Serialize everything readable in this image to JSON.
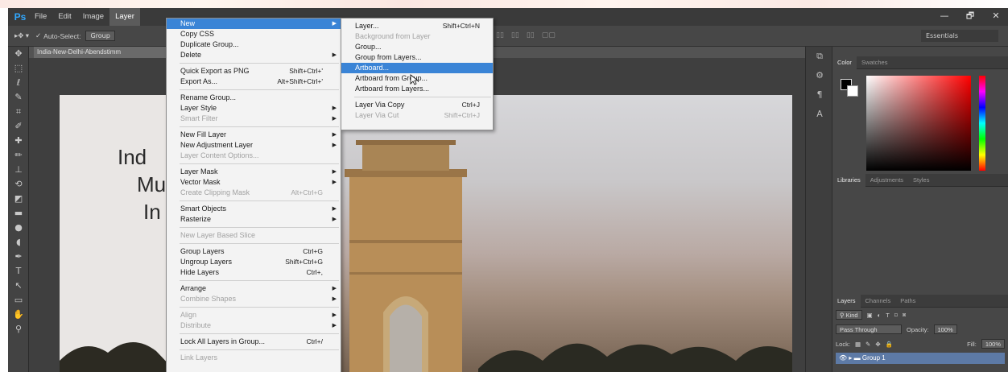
{
  "menubar": {
    "logo": "Ps",
    "menus": [
      "File",
      "Edit",
      "Image",
      "Layer"
    ],
    "active_index": 3,
    "window_controls": [
      "—",
      "🗗",
      "✕"
    ]
  },
  "options_bar": {
    "tool_label": "Auto-Select:",
    "group_value": "Group",
    "workspace": "Essentials"
  },
  "document": {
    "tab_title": "India-New-Delhi-Abendstimm",
    "canvas_text": [
      "Ind",
      "Mu",
      "In"
    ]
  },
  "layer_menu": {
    "items": [
      {
        "label": "New",
        "shortcut": "",
        "submenu": true,
        "state": "highlight"
      },
      {
        "label": "Copy CSS",
        "shortcut": "",
        "submenu": false,
        "state": "normal"
      },
      {
        "label": "Duplicate Group...",
        "shortcut": "",
        "submenu": false,
        "state": "normal"
      },
      {
        "label": "Delete",
        "shortcut": "",
        "submenu": true,
        "state": "normal"
      },
      {
        "sep": true
      },
      {
        "label": "Quick Export as PNG",
        "shortcut": "Shift+Ctrl+'",
        "submenu": false,
        "state": "normal"
      },
      {
        "label": "Export As...",
        "shortcut": "Alt+Shift+Ctrl+'",
        "submenu": false,
        "state": "normal"
      },
      {
        "sep": true
      },
      {
        "label": "Rename Group...",
        "shortcut": "",
        "submenu": false,
        "state": "normal"
      },
      {
        "label": "Layer Style",
        "shortcut": "",
        "submenu": true,
        "state": "normal"
      },
      {
        "label": "Smart Filter",
        "shortcut": "",
        "submenu": true,
        "state": "disabled"
      },
      {
        "sep": true
      },
      {
        "label": "New Fill Layer",
        "shortcut": "",
        "submenu": true,
        "state": "normal"
      },
      {
        "label": "New Adjustment Layer",
        "shortcut": "",
        "submenu": true,
        "state": "normal"
      },
      {
        "label": "Layer Content Options...",
        "shortcut": "",
        "submenu": false,
        "state": "disabled"
      },
      {
        "sep": true
      },
      {
        "label": "Layer Mask",
        "shortcut": "",
        "submenu": true,
        "state": "normal"
      },
      {
        "label": "Vector Mask",
        "shortcut": "",
        "submenu": true,
        "state": "normal"
      },
      {
        "label": "Create Clipping Mask",
        "shortcut": "Alt+Ctrl+G",
        "submenu": false,
        "state": "disabled"
      },
      {
        "sep": true
      },
      {
        "label": "Smart Objects",
        "shortcut": "",
        "submenu": true,
        "state": "normal"
      },
      {
        "label": "Rasterize",
        "shortcut": "",
        "submenu": true,
        "state": "normal"
      },
      {
        "sep": true
      },
      {
        "label": "New Layer Based Slice",
        "shortcut": "",
        "submenu": false,
        "state": "disabled"
      },
      {
        "sep": true
      },
      {
        "label": "Group Layers",
        "shortcut": "Ctrl+G",
        "submenu": false,
        "state": "normal"
      },
      {
        "label": "Ungroup Layers",
        "shortcut": "Shift+Ctrl+G",
        "submenu": false,
        "state": "normal"
      },
      {
        "label": "Hide Layers",
        "shortcut": "Ctrl+,",
        "submenu": false,
        "state": "normal"
      },
      {
        "sep": true
      },
      {
        "label": "Arrange",
        "shortcut": "",
        "submenu": true,
        "state": "normal"
      },
      {
        "label": "Combine Shapes",
        "shortcut": "",
        "submenu": true,
        "state": "disabled"
      },
      {
        "sep": true
      },
      {
        "label": "Align",
        "shortcut": "",
        "submenu": true,
        "state": "disabled"
      },
      {
        "label": "Distribute",
        "shortcut": "",
        "submenu": true,
        "state": "disabled"
      },
      {
        "sep": true
      },
      {
        "label": "Lock All Layers in Group...",
        "shortcut": "Ctrl+/",
        "submenu": false,
        "state": "normal"
      },
      {
        "sep": true
      },
      {
        "label": "Link Layers",
        "shortcut": "",
        "submenu": false,
        "state": "disabled"
      }
    ]
  },
  "new_submenu": {
    "items": [
      {
        "label": "Layer...",
        "shortcut": "Shift+Ctrl+N",
        "state": "normal"
      },
      {
        "label": "Background from Layer",
        "shortcut": "",
        "state": "disabled"
      },
      {
        "label": "Group...",
        "shortcut": "",
        "state": "normal"
      },
      {
        "label": "Group from Layers...",
        "shortcut": "",
        "state": "normal"
      },
      {
        "label": "Artboard...",
        "shortcut": "",
        "state": "highlight"
      },
      {
        "label": "Artboard from Group...",
        "shortcut": "",
        "state": "normal"
      },
      {
        "label": "Artboard from Layers...",
        "shortcut": "",
        "state": "normal"
      },
      {
        "sep": true
      },
      {
        "label": "Layer Via Copy",
        "shortcut": "Ctrl+J",
        "state": "normal"
      },
      {
        "label": "Layer Via Cut",
        "shortcut": "Shift+Ctrl+J",
        "state": "disabled"
      }
    ]
  },
  "panels": {
    "color_tabs": [
      "Color",
      "Swatches"
    ],
    "libs_tabs": [
      "Libraries",
      "Adjustments",
      "Styles"
    ],
    "layers_tabs": [
      "Layers",
      "Channels",
      "Paths"
    ],
    "kind_label": "Kind",
    "blend_mode": "Pass Through",
    "opacity_label": "Opacity:",
    "opacity_value": "100%",
    "lock_label": "Lock:",
    "fill_label": "Fill:",
    "fill_value": "100%",
    "group_name": "Group 1"
  },
  "colors": {
    "menu_highlight": "#3a84d6",
    "app_bg": "#535353",
    "layer_selected": "#5d7aa6"
  }
}
